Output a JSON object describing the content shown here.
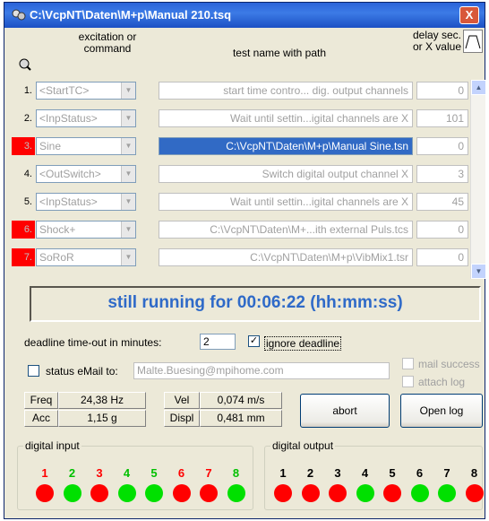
{
  "window": {
    "title": "C:\\VcpNT\\Daten\\M+p\\Manual 210.tsq",
    "close": "X",
    "appicon": "app-icon"
  },
  "headers": {
    "excitation": [
      "excitation or",
      "command"
    ],
    "testname": "test name with path",
    "delay": [
      "delay sec.",
      "or X value"
    ]
  },
  "rows": [
    {
      "num": "1.",
      "red": false,
      "cmd": "<StartTC>",
      "path": "start time contro... dig. output channels",
      "value": "0",
      "selected": false
    },
    {
      "num": "2.",
      "red": false,
      "cmd": "<InpStatus>",
      "path": "Wait until settin...igital channels are X",
      "value": "101",
      "selected": false
    },
    {
      "num": "3.",
      "red": true,
      "cmd": "Sine",
      "path": "C:\\VcpNT\\Daten\\M+p\\Manual Sine.tsn",
      "value": "0",
      "selected": true
    },
    {
      "num": "4.",
      "red": false,
      "cmd": "<OutSwitch>",
      "path": "Switch digital output channel X",
      "value": "3",
      "selected": false
    },
    {
      "num": "5.",
      "red": false,
      "cmd": "<InpStatus>",
      "path": "Wait until settin...igital channels are X",
      "value": "45",
      "selected": false
    },
    {
      "num": "6.",
      "red": true,
      "cmd": "Shock+",
      "path": "C:\\VcpNT\\Daten\\M+...ith external Puls.tcs",
      "value": "0",
      "selected": false
    },
    {
      "num": "7.",
      "red": true,
      "cmd": "SoRoR",
      "path": "C:\\VcpNT\\Daten\\M+p\\VibMix1.tsr",
      "value": "0",
      "selected": false
    }
  ],
  "status": "still running for 00:06:22 (hh:mm:ss)",
  "deadline": {
    "label": "deadline time-out in minutes:",
    "value": "2",
    "ignore_label": "ignore deadline",
    "ignore_checked": "✓"
  },
  "email": {
    "label": "status eMail to:",
    "value": "Malte.Buesing@mpihome.com",
    "mail_success": "mail success",
    "attach_log": "attach log"
  },
  "measurements": {
    "freq_label": "Freq",
    "freq": "24,38 Hz",
    "acc_label": "Acc",
    "acc": "1,15 g",
    "vel_label": "Vel",
    "vel": "0,074 m/s",
    "displ_label": "Displ",
    "displ": "0,481 mm"
  },
  "buttons": {
    "abort": "abort",
    "open_log": "Open log"
  },
  "digital_input": {
    "label": "digital input",
    "channels": [
      {
        "n": "1",
        "on": false
      },
      {
        "n": "2",
        "on": true
      },
      {
        "n": "3",
        "on": false
      },
      {
        "n": "4",
        "on": true
      },
      {
        "n": "5",
        "on": true
      },
      {
        "n": "6",
        "on": false
      },
      {
        "n": "7",
        "on": false
      },
      {
        "n": "8",
        "on": true
      }
    ]
  },
  "digital_output": {
    "label": "digital output",
    "channels": [
      {
        "n": "1",
        "on": false
      },
      {
        "n": "2",
        "on": false
      },
      {
        "n": "3",
        "on": false
      },
      {
        "n": "4",
        "on": true
      },
      {
        "n": "5",
        "on": false
      },
      {
        "n": "6",
        "on": true
      },
      {
        "n": "7",
        "on": true
      },
      {
        "n": "8",
        "on": false
      }
    ]
  },
  "colors": {
    "on": "#00E000",
    "off": "#FF0000",
    "status_text": "#2F6AC8",
    "selection": "#316AC5"
  }
}
